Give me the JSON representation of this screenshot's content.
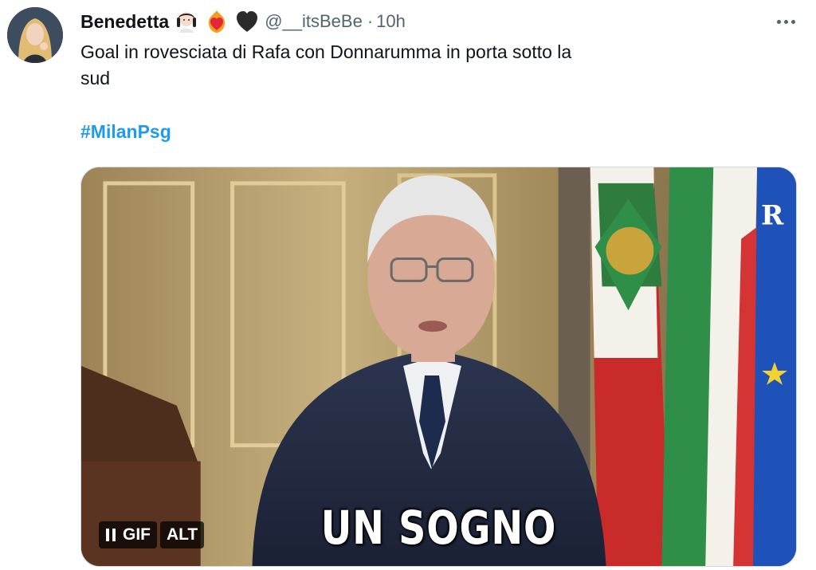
{
  "tweet": {
    "display_name": "Benedetta",
    "handle": "@__itsBeBe",
    "separator": "·",
    "time": "10h",
    "text": "Goal in rovesciata di Rafa con Donnarumma in porta sotto la\nsud",
    "hashtag": "#MilanPsg",
    "name_emojis": [
      "person-emoji",
      "flaming-heart-emoji",
      "black-heart-emoji"
    ],
    "more_icon": "more-options-icon"
  },
  "media": {
    "caption": "UN SOGNO",
    "pause_icon": "pause-icon",
    "gif_label": "GIF",
    "alt_label": "ALT"
  },
  "colors": {
    "hashtag": "#1d9bf0",
    "secondary_text": "#536471",
    "primary_text": "#0f1419"
  }
}
